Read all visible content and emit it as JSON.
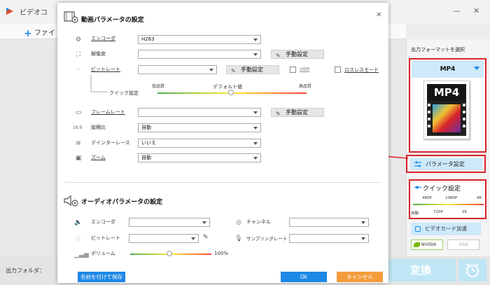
{
  "app": {
    "title": "ビデオコ",
    "add_label": "ファイ",
    "output_folder_label": "出力フォルダ：",
    "convert_label": "変換"
  },
  "right_panel": {
    "select_format_label": "出力フォーマットを選択",
    "format_name": "MP4",
    "format_icon_text": "MP4",
    "param_settings_label": "パラメータ設定",
    "quick_settings_label": "クイック設定",
    "quick_resolutions_top": [
      "480P",
      "1080P",
      "4K"
    ],
    "quick_resolutions_bottom": [
      "自動",
      "720P",
      "2K"
    ],
    "gpu_accel_label": "ビデオカード加速",
    "nvidia_label": "NVIDIA",
    "intel_label": "intel"
  },
  "dialog": {
    "video_section_title": "動画パラメータの設定",
    "video": {
      "encoder_label": "エンコーダ",
      "encoder_value": "H263",
      "resolution_label": "解像度",
      "resolution_value": "",
      "bitrate_label": "ビットレート",
      "bitrate_value": "",
      "quick_settings_label": "クイック設定",
      "quality_low": "低品質",
      "quality_default": "デフォルト値",
      "quality_high": "高品質",
      "vbr_label": "VBR",
      "lossless_label": "ロスレスモード",
      "framerate_label": "フレームレート",
      "framerate_value": "",
      "aspect_label": "縦横比",
      "aspect_value": "自動",
      "deinterlace_label": "デインターレース",
      "deinterlace_value": "いいえ",
      "zoom_label": "ズーム",
      "zoom_value": "自動",
      "manual_label": "手動設定"
    },
    "audio_section_title": "オーディオパラメータの設定",
    "audio": {
      "encoder_label": "エンコーダ",
      "encoder_value": "",
      "bitrate_label": "ビットレート",
      "bitrate_value": "",
      "volume_label": "ボリューム",
      "volume_value": "100%",
      "channel_label": "チャンネル",
      "channel_value": "",
      "samplerate_label": "サンプリングレート",
      "samplerate_value": ""
    },
    "save_named_label": "名前を付けて保存",
    "ok_label": "Ok",
    "cancel_label": "キャンセル",
    "colors": {
      "accent_blue": "#1e88e5",
      "cancel_orange": "#f39c3c",
      "highlight_red": "#d9232a"
    }
  }
}
